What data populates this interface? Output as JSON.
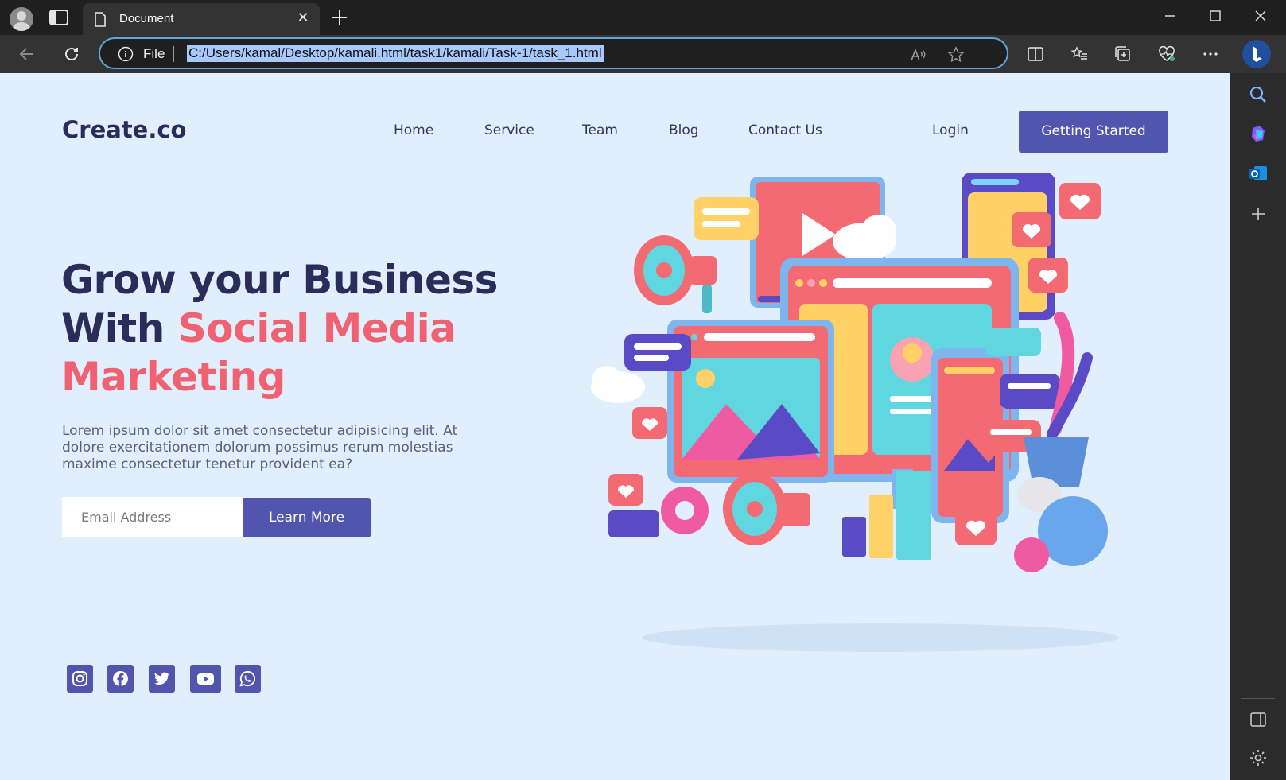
{
  "browser": {
    "tab_title": "Document",
    "address_scheme": "File",
    "url": "C:/Users/kamal/Desktop/kamali.html/task1/kamali/Task-1/task_1.html"
  },
  "site": {
    "logo": "Create.co",
    "nav": [
      "Home",
      "Service",
      "Team",
      "Blog",
      "Contact Us"
    ],
    "login": "Login",
    "cta": "Getting Started"
  },
  "hero": {
    "heading_line1": "Grow your Business",
    "heading_line2_plain": "With ",
    "heading_line2_highlight": "Social Media",
    "heading_line3": "Marketing",
    "paragraph": "Lorem ipsum dolor sit amet consectetur adipisicing elit. At dolore exercitationem dolorum possimus rerum molestias maxime consectetur tenetur provident ea?",
    "email_placeholder": "Email Address",
    "learn_more": "Learn More"
  },
  "social_icons": [
    "instagram-icon",
    "facebook-icon",
    "twitter-icon",
    "youtube-icon",
    "whatsapp-icon"
  ],
  "colors": {
    "page_bg": "#e1effd",
    "primary": "#5155ad",
    "heading": "#2a2d59",
    "accent": "#f06272"
  }
}
